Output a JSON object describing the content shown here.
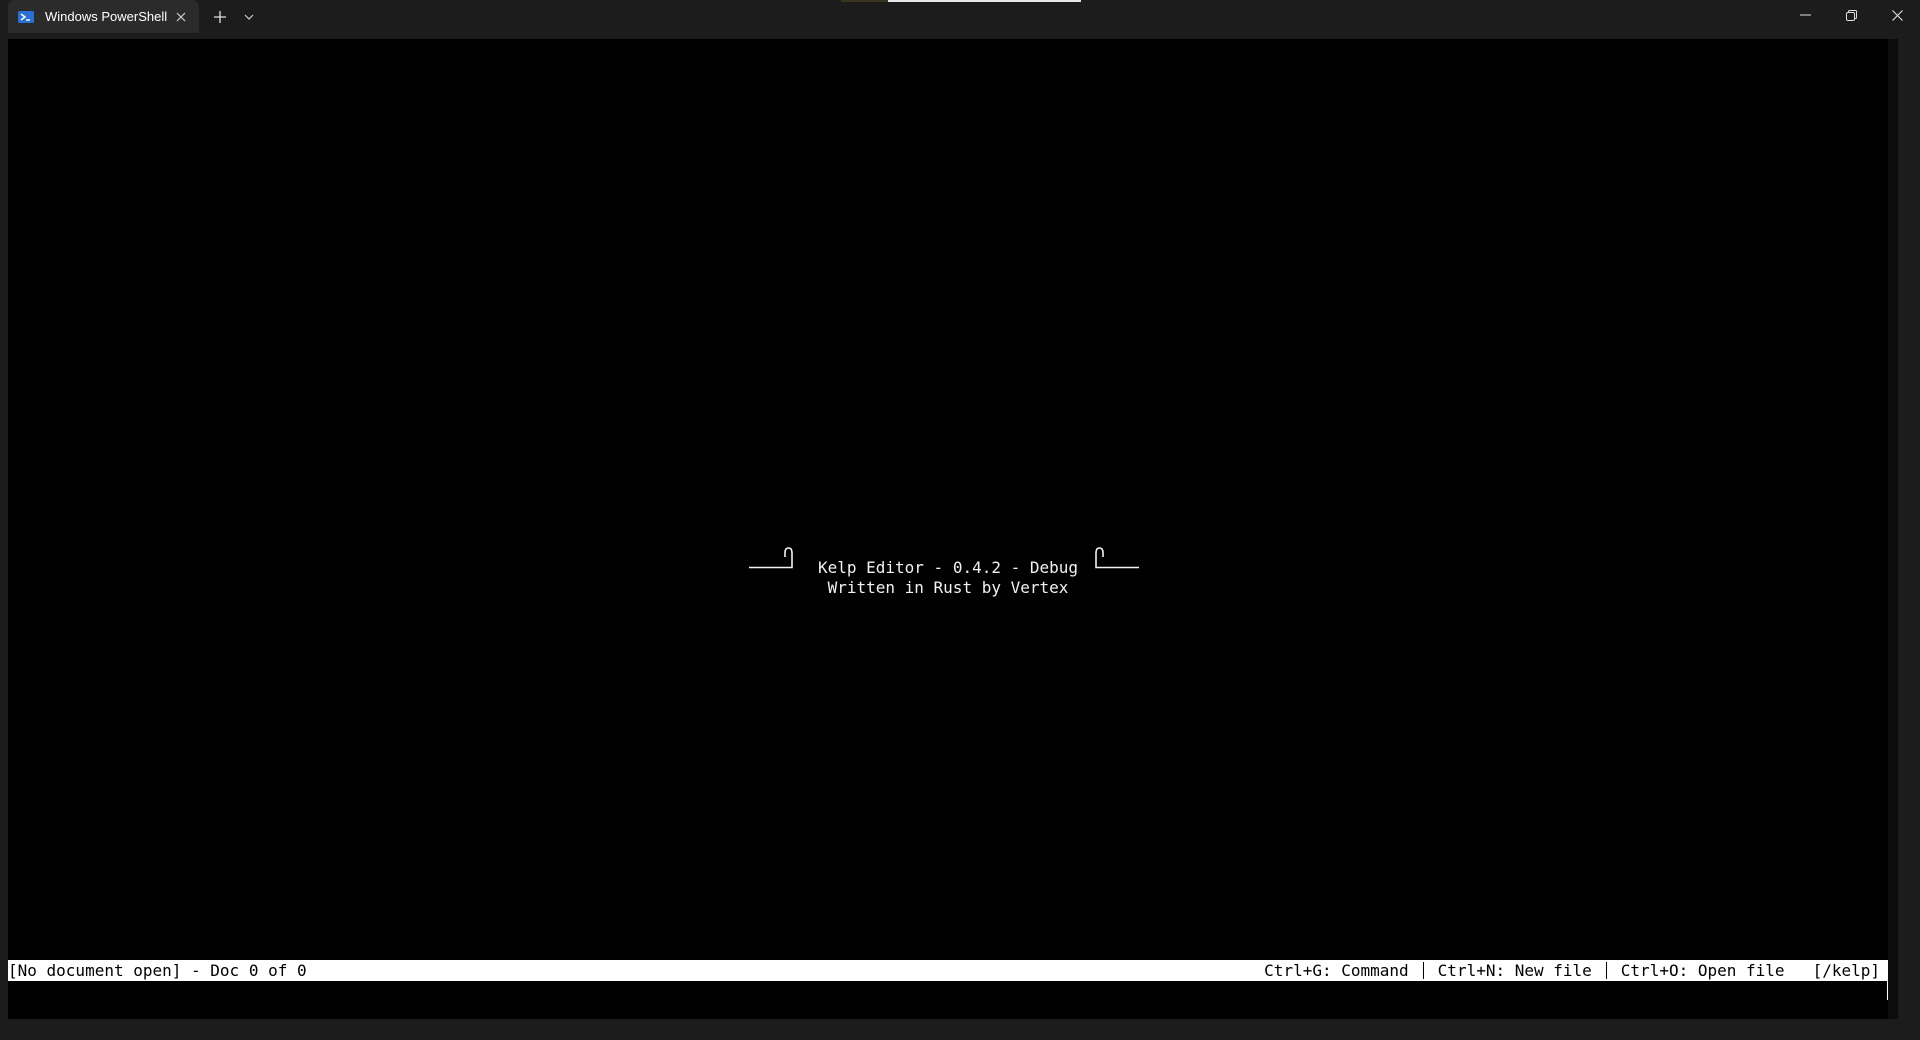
{
  "window": {
    "tab_title": "Windows PowerShell",
    "new_tab_label": "+",
    "controls": {
      "minimize_icon": "minimize-icon",
      "restore_icon": "restore-icon",
      "close_icon": "close-icon"
    }
  },
  "editor": {
    "splash_title": "Kelp Editor - 0.4.2 - Debug",
    "splash_subtitle": "Written in Rust by Vertex"
  },
  "status_bar": {
    "left": "[No document open] - Doc 0 of 0",
    "shortcuts": [
      "Ctrl+G: Command",
      "Ctrl+N: New file",
      "Ctrl+O: Open file"
    ],
    "path": "[/kelp]"
  },
  "colors": {
    "titlebar_bg": "#1c1c1c",
    "tab_bg": "#2b2b2b",
    "terminal_bg": "#000000",
    "status_bg": "#ffffff",
    "text": "#f2f2f2",
    "powershell_blue": "#2a6fd6"
  }
}
